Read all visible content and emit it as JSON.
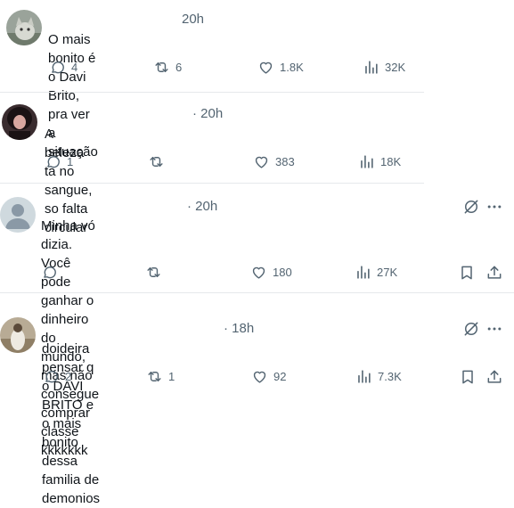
{
  "replies": [
    {
      "time": "20h",
      "text_lines": [
        "O mais bonito é o Davi Brito, pra ver a situação"
      ],
      "replies": "4",
      "reposts": "6",
      "likes": "1.8K",
      "views": "32K"
    },
    {
      "time": "· 20h",
      "text_lines": [
        "A beleza ta no sangue, so falta circular"
      ],
      "replies": "1",
      "reposts": "",
      "likes": "383",
      "views": "18K"
    },
    {
      "time": "· 20h",
      "text_lines": [
        "Minha vó dizia. Você pode ganhar o dinheiro do mundo, mas não consegue",
        "comprar classe kkkkkkk"
      ],
      "replies": "",
      "reposts": "",
      "likes": "180",
      "views": "27K"
    },
    {
      "time": "· 18h",
      "text_lines": [
        "doideira pensar q o DAVI BRITO e o mais bonito dessa familia de demonios"
      ],
      "replies": "2",
      "reposts": "1",
      "likes": "92",
      "views": "7.3K"
    }
  ],
  "colors": {
    "text": "#0f1419",
    "muted": "#536471",
    "divider": "#e6e9eb"
  }
}
